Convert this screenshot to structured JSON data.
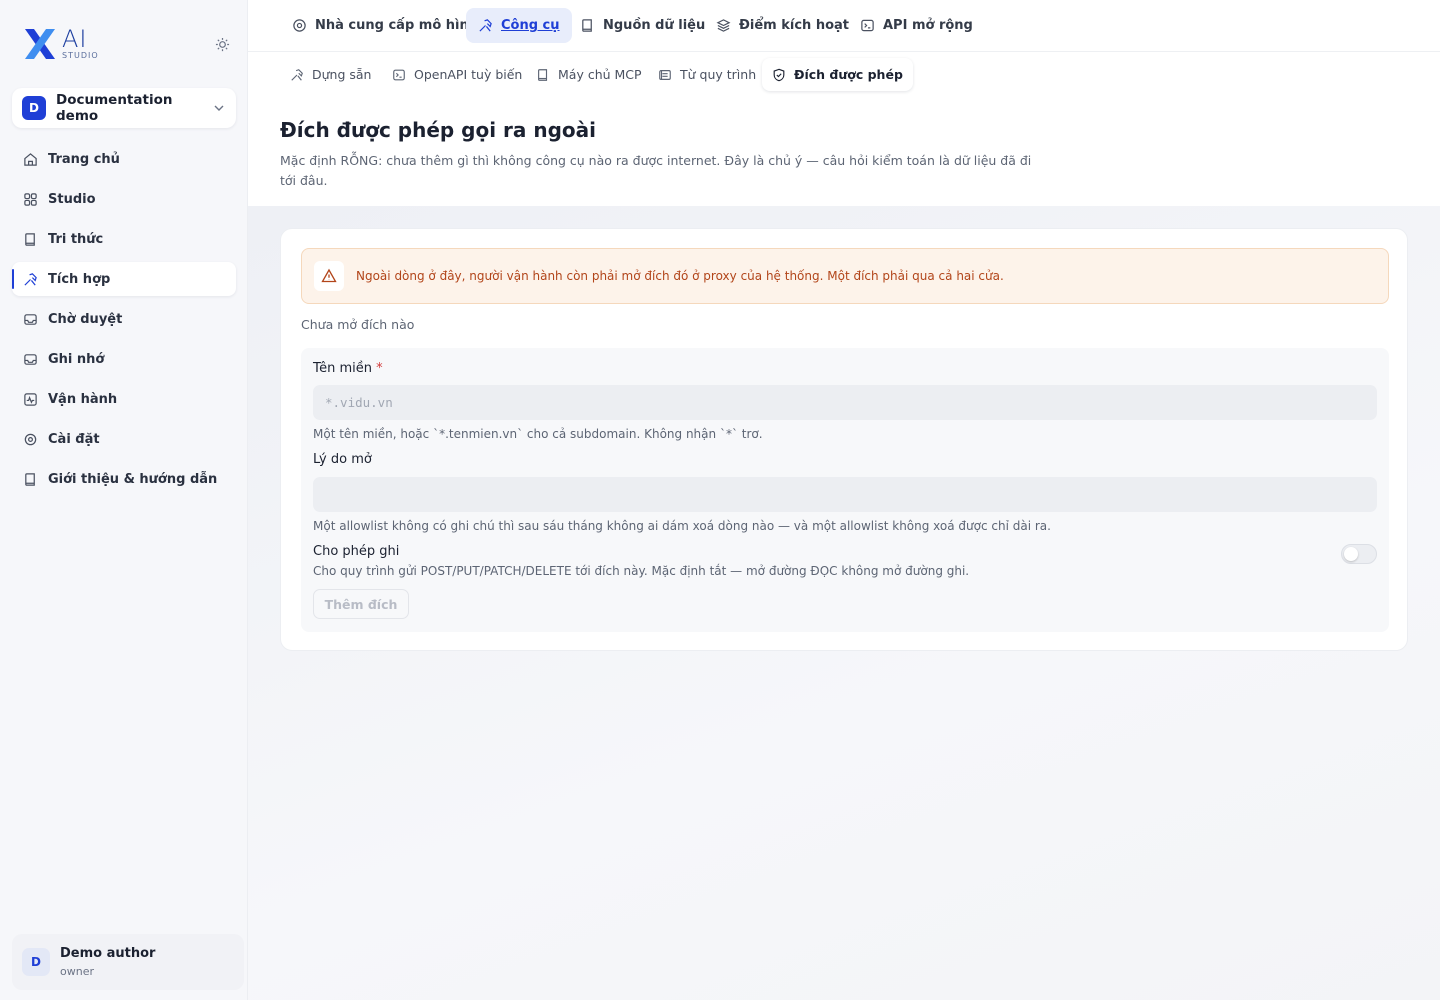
{
  "brand": {
    "logo_ai": "AI",
    "logo_studio": "STUDIO",
    "accent": "#1f3fd6"
  },
  "workspace": {
    "initial": "D",
    "name": "Documentation demo"
  },
  "sidebar": {
    "items": [
      {
        "label": "Trang chủ",
        "icon": "home-icon"
      },
      {
        "label": "Studio",
        "icon": "grid-icon"
      },
      {
        "label": "Tri thức",
        "icon": "book-icon"
      },
      {
        "label": "Tích hợp",
        "icon": "tools-icon",
        "active": true
      },
      {
        "label": "Chờ duyệt",
        "icon": "inbox-icon"
      },
      {
        "label": "Ghi nhớ",
        "icon": "inbox-icon"
      },
      {
        "label": "Vận hành",
        "icon": "activity-icon"
      },
      {
        "label": "Cài đặt",
        "icon": "gear-icon"
      },
      {
        "label": "Giới thiệu & hướng dẫn",
        "icon": "book-icon"
      }
    ]
  },
  "user": {
    "initial": "D",
    "name": "Demo author",
    "role": "owner"
  },
  "top_tabs": [
    {
      "label": "Nhà cung cấp mô hình",
      "icon": "provider-icon"
    },
    {
      "label": "Công cụ",
      "icon": "tools-icon",
      "active": true
    },
    {
      "label": "Nguồn dữ liệu",
      "icon": "book-icon"
    },
    {
      "label": "Điểm kích hoạt",
      "icon": "layers-icon"
    },
    {
      "label": "API mở rộng",
      "icon": "terminal-icon"
    }
  ],
  "sub_tabs": [
    {
      "label": "Dựng sẵn",
      "icon": "tools-icon"
    },
    {
      "label": "OpenAPI tuỳ biến",
      "icon": "terminal-icon"
    },
    {
      "label": "Máy chủ MCP",
      "icon": "book-icon"
    },
    {
      "label": "Từ quy trình",
      "icon": "list-icon"
    },
    {
      "label": "Đích được phép",
      "icon": "shield-icon",
      "active": true
    }
  ],
  "page": {
    "title": "Đích được phép gọi ra ngoài",
    "description": "Mặc định RỖNG: chưa thêm gì thì không công cụ nào ra được internet. Đây là chủ ý — câu hỏi kiểm toán là dữ liệu đã đi tới đâu."
  },
  "alert": {
    "text": "Ngoài dòng ở đây, người vận hành còn phải mở đích đó ở proxy của hệ thống. Một đích phải qua cả hai cửa."
  },
  "empty_state": "Chưa mở đích nào",
  "form": {
    "domain_label": "Tên miền",
    "required_mark": "*",
    "domain_placeholder": "*.vidu.vn",
    "domain_value": "",
    "domain_help": "Một tên miền, hoặc `*.tenmien.vn` cho cả subdomain. Không nhận `*` trơ.",
    "reason_label": "Lý do mở",
    "reason_placeholder": "",
    "reason_value": "",
    "reason_help": "Một allowlist không có ghi chú thì sau sáu tháng không ai dám xoá dòng nào — và một allowlist không xoá được chỉ dài ra.",
    "write_label": "Cho phép ghi",
    "write_help": "Cho quy trình gửi POST/PUT/PATCH/DELETE tới đích này. Mặc định tắt — mở đường ĐỌC không mở đường ghi.",
    "write_enabled": false,
    "submit_label": "Thêm đích"
  }
}
